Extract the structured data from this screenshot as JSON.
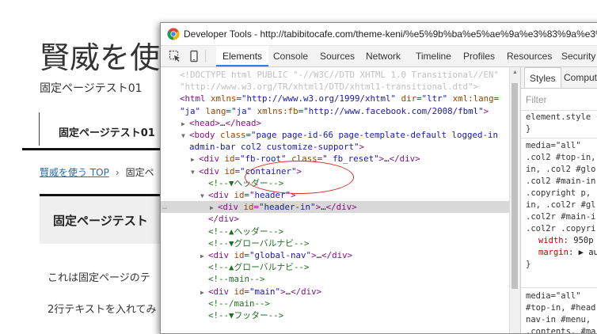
{
  "page": {
    "title": "賢威を使",
    "subtitle": "固定ページテスト01",
    "nav_item": "固定ページテスト01",
    "breadcrumb_link": "賢威を使う TOP",
    "breadcrumb_sep": "›",
    "breadcrumb_current": "固定ペ",
    "box_title": "固定ページテスト",
    "body_text_1": "これは固定ページのテ",
    "body_text_2": "2行テキストを入れてみ"
  },
  "devtools": {
    "window_title": "Developer Tools - http://tabibitocafe.com/theme-keni/%e5%9b%ba%e5%ae%9a%e3%83%9a%e3%83",
    "tabs": [
      "Elements",
      "Console",
      "Sources",
      "Network",
      "Timeline",
      "Profiles",
      "Resources",
      "Security"
    ],
    "active_tab": "Elements",
    "sidebar_tabs": [
      "Styles",
      "Computed"
    ],
    "filter_placeholder": "Filter",
    "dom_lines": [
      {
        "indent": 0,
        "tri": "",
        "parts": [
          [
            "dt",
            "<!DOCTYPE html PUBLIC \"-//W3C//DTD XHTML 1.0 Transitional//EN\""
          ]
        ]
      },
      {
        "indent": 0,
        "tri": "",
        "parts": [
          [
            "dt",
            "\"http://www.w3.org/TR/xhtml1/DTD/xhtml1-transitional.dtd\">"
          ]
        ]
      },
      {
        "indent": 0,
        "tri": "",
        "parts": [
          [
            "tag",
            "<html "
          ],
          [
            "an",
            "xmlns"
          ],
          [
            "tag",
            "="
          ],
          [
            "av",
            "\"http://www.w3.org/1999/xhtml\""
          ],
          [
            "tag",
            " "
          ],
          [
            "an",
            "dir"
          ],
          [
            "tag",
            "="
          ],
          [
            "av",
            "\"ltr\""
          ],
          [
            "tag",
            " "
          ],
          [
            "an",
            "xml:lang"
          ],
          [
            "tag",
            "="
          ]
        ]
      },
      {
        "indent": 0,
        "tri": "",
        "parts": [
          [
            "av",
            "\"ja\""
          ],
          [
            "tag",
            " "
          ],
          [
            "an",
            "lang"
          ],
          [
            "tag",
            "="
          ],
          [
            "av",
            "\"ja\""
          ],
          [
            "tag",
            " "
          ],
          [
            "an",
            "xmlns:fb"
          ],
          [
            "tag",
            "="
          ],
          [
            "av",
            "\"http://www.facebook.com/2008/fbml\""
          ],
          [
            "tag",
            ">"
          ]
        ]
      },
      {
        "indent": 1,
        "tri": "▶",
        "parts": [
          [
            "tag",
            "<head>"
          ],
          [
            "tx",
            "…"
          ],
          [
            "tag",
            "</head>"
          ]
        ]
      },
      {
        "indent": 1,
        "tri": "▼",
        "parts": [
          [
            "tag",
            "<body "
          ],
          [
            "an",
            "class"
          ],
          [
            "tag",
            "="
          ],
          [
            "av",
            "\"page page-id-66 page-template-default logged-in"
          ]
        ]
      },
      {
        "indent": 1,
        "tri": "",
        "parts": [
          [
            "av",
            "admin-bar col2 customize-support\""
          ],
          [
            "tag",
            ">"
          ]
        ]
      },
      {
        "indent": 2,
        "tri": "▶",
        "parts": [
          [
            "tag",
            "<div "
          ],
          [
            "an",
            "id"
          ],
          [
            "tag",
            "="
          ],
          [
            "av",
            "\"fb-root\""
          ],
          [
            "tag",
            " "
          ],
          [
            "an",
            "class"
          ],
          [
            "tag",
            "="
          ],
          [
            "av",
            "\" fb_reset\""
          ],
          [
            "tag",
            ">"
          ],
          [
            "tx",
            "…"
          ],
          [
            "tag",
            "</div>"
          ]
        ]
      },
      {
        "indent": 2,
        "tri": "▼",
        "parts": [
          [
            "tag",
            "<div "
          ],
          [
            "an",
            "id"
          ],
          [
            "tag",
            "="
          ],
          [
            "av",
            "\"container\""
          ],
          [
            "tag",
            ">"
          ]
        ]
      },
      {
        "indent": 3,
        "tri": "",
        "parts": [
          [
            "cm",
            "<!--▼ヘッダー-->"
          ]
        ]
      },
      {
        "indent": 3,
        "tri": "▼",
        "parts": [
          [
            "tag",
            "<div "
          ],
          [
            "an",
            "id"
          ],
          [
            "tag",
            "="
          ],
          [
            "av",
            "\"header\""
          ],
          [
            "tag",
            ">"
          ]
        ]
      },
      {
        "indent": 4,
        "tri": "▶",
        "parts": [
          [
            "tag",
            "<div "
          ],
          [
            "an",
            "id"
          ],
          [
            "tag",
            "="
          ],
          [
            "av",
            "\"header-in\""
          ],
          [
            "tag",
            ">"
          ],
          [
            "tx",
            "…"
          ],
          [
            "tag",
            "</div>"
          ]
        ],
        "selected": true
      },
      {
        "indent": 3,
        "tri": "",
        "parts": [
          [
            "tag",
            "</div>"
          ]
        ]
      },
      {
        "indent": 3,
        "tri": "",
        "parts": [
          [
            "cm",
            "<!--▲ヘッダー-->"
          ]
        ]
      },
      {
        "indent": 3,
        "tri": "",
        "parts": [
          [
            "cm",
            "<!--▼グローバルナビ-->"
          ]
        ]
      },
      {
        "indent": 3,
        "tri": "▶",
        "parts": [
          [
            "tag",
            "<div "
          ],
          [
            "an",
            "id"
          ],
          [
            "tag",
            "="
          ],
          [
            "av",
            "\"global-nav\""
          ],
          [
            "tag",
            ">"
          ],
          [
            "tx",
            "…"
          ],
          [
            "tag",
            "</div>"
          ]
        ]
      },
      {
        "indent": 3,
        "tri": "",
        "parts": [
          [
            "cm",
            "<!--▲グローバルナビ-->"
          ]
        ]
      },
      {
        "indent": 3,
        "tri": "",
        "parts": [
          [
            "cm",
            "<!--main-->"
          ]
        ]
      },
      {
        "indent": 3,
        "tri": "▶",
        "parts": [
          [
            "tag",
            "<div "
          ],
          [
            "an",
            "id"
          ],
          [
            "tag",
            "="
          ],
          [
            "av",
            "\"main\""
          ],
          [
            "tag",
            ">"
          ],
          [
            "tx",
            "…"
          ],
          [
            "tag",
            "</div>"
          ]
        ]
      },
      {
        "indent": 3,
        "tri": "",
        "parts": [
          [
            "cm",
            "<!--/main-->"
          ]
        ]
      },
      {
        "indent": 3,
        "tri": "",
        "parts": [
          [
            "cm",
            "<!--▼フッター-->"
          ]
        ]
      }
    ],
    "styles": {
      "element_style": "element.style {",
      "brace_close": "}",
      "rule1": {
        "media": "media=\"all\"",
        "selectors": [
          ".col2 #top-in,",
          "in, .col2 #glo",
          ".col2 #main-in",
          ".copyright p,",
          "in, .col2r #gl",
          ".col2r #main-i",
          ".col2r .copyri"
        ],
        "props": [
          [
            "width",
            "950p"
          ],
          [
            "margin",
            "▶ au"
          ]
        ]
      },
      "rule2": {
        "media": "media=\"all\"",
        "selectors": [
          "#top-in, #head",
          "nav-in #menu,",
          ".contents, #ma"
        ]
      }
    }
  }
}
